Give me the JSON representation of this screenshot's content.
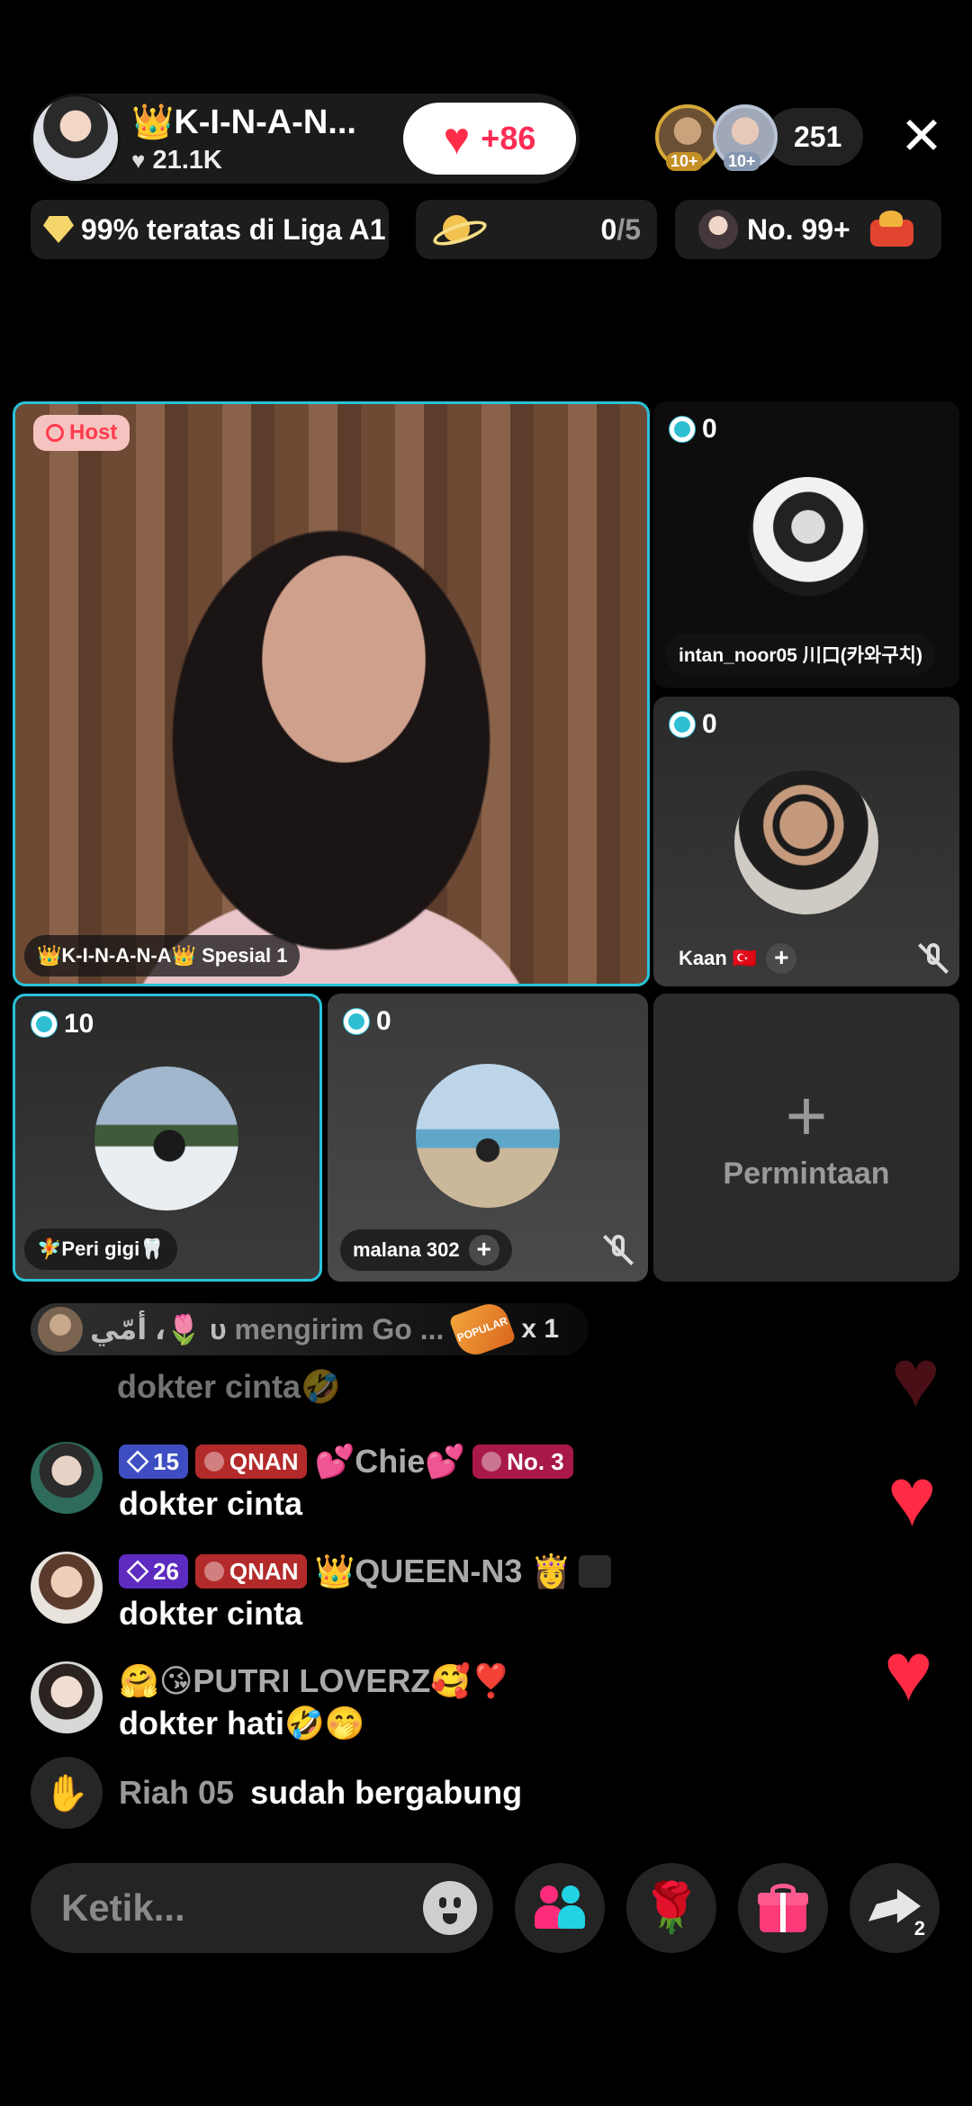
{
  "header": {
    "host_name": "👑K-I-N-A-N...",
    "host_likes": "21.1K",
    "like_button_count": "+86",
    "viewer_badges": [
      "10+",
      "10+"
    ],
    "viewer_count": "251",
    "close_icon": "close-icon"
  },
  "stats_row": {
    "league_text": "99% teratas di Liga A1",
    "goal_current": "0",
    "goal_total": "/5",
    "rank_text": "No. 99+"
  },
  "host_cell": {
    "tag": "Host",
    "name": "👑K-I-N-A-N-A👑 Spesial 1"
  },
  "guests": {
    "intan": {
      "score": "0",
      "name": "intan_noor05 川口(카와구치)"
    },
    "kaan": {
      "score": "0",
      "name": "Kaan 🇹🇷",
      "plus": "+"
    },
    "peri": {
      "score": "10",
      "name": "🧚Peri gigi🦷"
    },
    "malana": {
      "score": "0",
      "name": "malana 302",
      "plus": "+"
    },
    "request": {
      "plus": "+",
      "label": "Permintaan"
    }
  },
  "gift_banner": {
    "sender": "أمّي ،🌷 υ",
    "text": "mengirim Go ...",
    "gift_label": "POPULAR",
    "count": "x 1"
  },
  "chat": {
    "faded_text": "dokter cinta🤣",
    "messages": [
      {
        "level": "15",
        "fan_badge": "QNAN",
        "name": "💕Chie💕",
        "rank_badge": "No. 3",
        "text": "dokter cinta"
      },
      {
        "level": "26",
        "fan_badge": "QNAN",
        "name": "👑QUEEN-N3 👸",
        "text": "dokter cinta"
      },
      {
        "name": "🤗😘PUTRI LOVERZ🥰❣️",
        "text": "dokter hati🤣🤭"
      }
    ],
    "join": {
      "name": "Riah 05",
      "text": "sudah bergabung"
    }
  },
  "bottom_bar": {
    "input_placeholder": "Ketik...",
    "share_count": "2"
  },
  "colors": {
    "accent_cyan": "#29c3d8",
    "like_red": "#fe2c55",
    "background": "#000000"
  }
}
